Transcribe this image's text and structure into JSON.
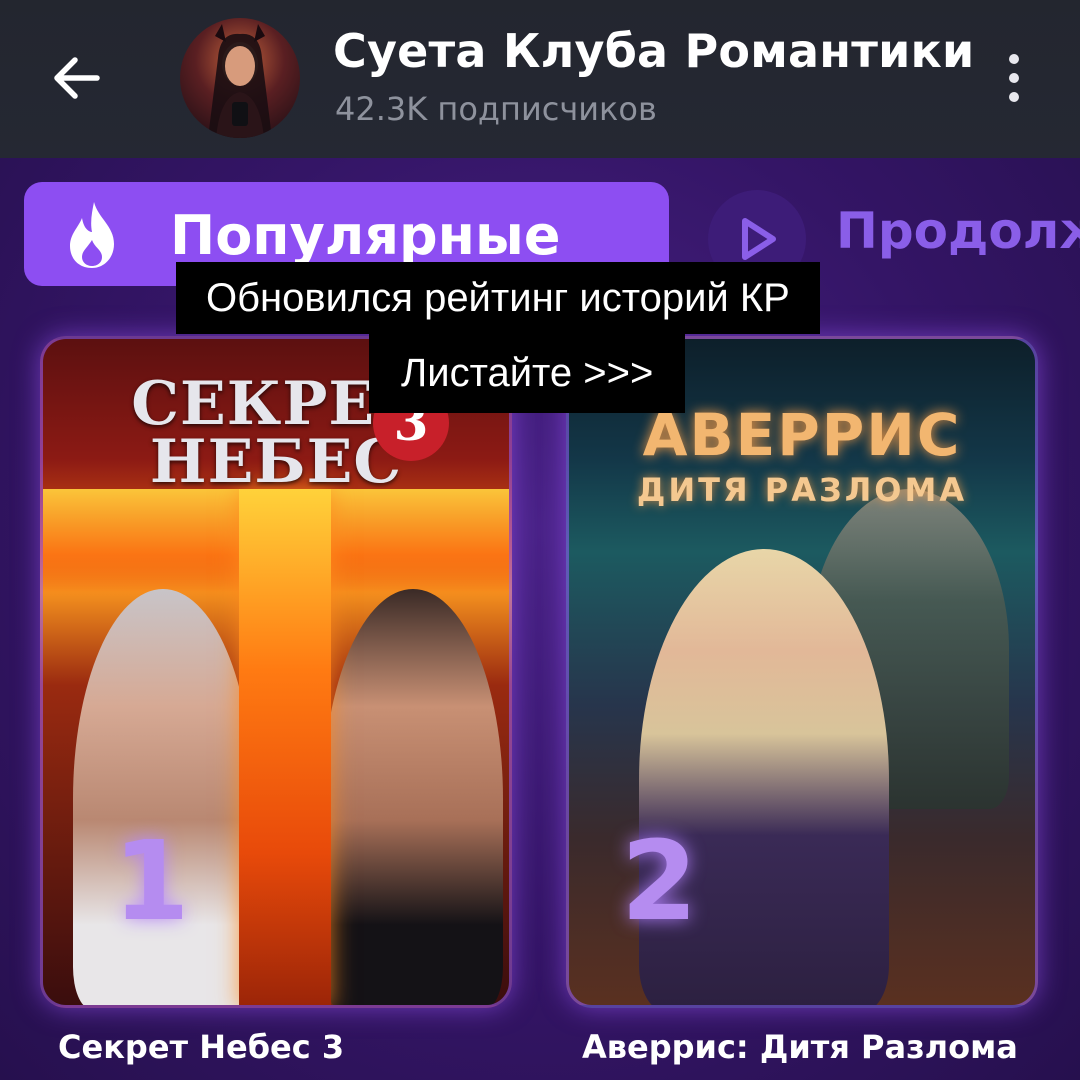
{
  "header": {
    "back_icon": "arrow-left-icon",
    "channel_title": "Суета Клуба Романтики",
    "subscribers": "42.3K подписчиков",
    "menu_icon": "more-vertical-icon"
  },
  "post": {
    "tabs": [
      {
        "label": "Популярные",
        "icon": "flame-icon",
        "selected": true,
        "color": "#8d4ef2"
      },
      {
        "label": "Продолж",
        "icon": "play-icon",
        "selected": false,
        "color": "#8a5ee8"
      }
    ],
    "overlay": {
      "line1": "Обновился рейтинг историй КР",
      "line2": "Листайте >>>"
    },
    "cards": [
      {
        "rank": "1",
        "art_title_line1": "СЕКРЕТ",
        "art_title_line2": "НЕБЕС",
        "art_badge": "3",
        "caption": "Секрет Небес 3"
      },
      {
        "rank": "2",
        "art_title": "АВЕРРИС",
        "art_subtitle": "ДИТЯ РАЗЛОМА",
        "caption": "Аверрис: Дитя Разлома"
      }
    ]
  },
  "colors": {
    "header_bg": "#23262f",
    "post_bg": "#3a1a6e",
    "accent": "#8d4ef2"
  }
}
